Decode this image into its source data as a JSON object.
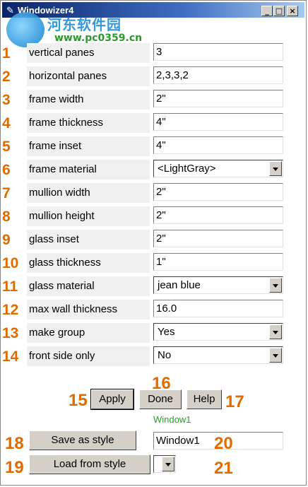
{
  "window": {
    "title": "Windowizer4",
    "controls": [
      "_",
      "□",
      "×"
    ]
  },
  "watermark": {
    "site_name": "河东软件园",
    "url": "www.pc0359.cn"
  },
  "rows": [
    {
      "num": "1",
      "label": "vertical panes",
      "value": "3",
      "type": "text"
    },
    {
      "num": "2",
      "label": "horizontal panes",
      "value": "2,3,3,2",
      "type": "text"
    },
    {
      "num": "3",
      "label": "frame width",
      "value": "2\"",
      "type": "text"
    },
    {
      "num": "4",
      "label": "frame thickness",
      "value": "4\"",
      "type": "text"
    },
    {
      "num": "5",
      "label": "frame inset",
      "value": "4\"",
      "type": "text"
    },
    {
      "num": "6",
      "label": "frame material",
      "value": "<LightGray>",
      "type": "select"
    },
    {
      "num": "7",
      "label": "mullion width",
      "value": "2\"",
      "type": "text"
    },
    {
      "num": "8",
      "label": "mullion height",
      "value": "2\"",
      "type": "text"
    },
    {
      "num": "9",
      "label": "glass inset",
      "value": "2\"",
      "type": "text"
    },
    {
      "num": "10",
      "label": "glass thickness",
      "value": "1\"",
      "type": "text"
    },
    {
      "num": "11",
      "label": "glass material",
      "value": "jean blue",
      "type": "select"
    },
    {
      "num": "12",
      "label": "max wall thickness",
      "value": "16.0",
      "type": "text"
    },
    {
      "num": "13",
      "label": "make group",
      "value": "Yes",
      "type": "select"
    },
    {
      "num": "14",
      "label": "front side only",
      "value": "No",
      "type": "select"
    }
  ],
  "buttons": {
    "apply": "Apply",
    "done": "Done",
    "help": "Help",
    "save_style": "Save as style",
    "load_style": "Load from style"
  },
  "annotations": {
    "apply": "15",
    "done": "16",
    "help": "17",
    "save_style": "18",
    "load_style": "19",
    "style_name": "20",
    "style_select": "21"
  },
  "style_label": "Window1",
  "style_name_value": "Window1",
  "style_select_value": ""
}
